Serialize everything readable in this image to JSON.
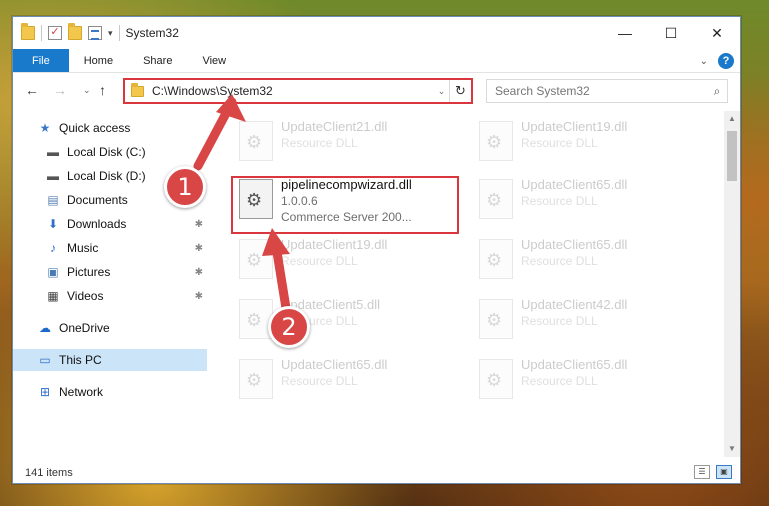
{
  "titlebar": {
    "title": "System32",
    "qa_dropdown": "▾",
    "buttons": {
      "minimize": "—",
      "maximize": "☐",
      "close": "✕"
    }
  },
  "ribbon": {
    "tabs": [
      "File",
      "Home",
      "Share",
      "View"
    ],
    "collapse": "⌄",
    "help": "?"
  },
  "navigation": {
    "back": "←",
    "forward": "→",
    "recent": "⌄",
    "up": "↑",
    "address": "C:\\Windows\\System32",
    "address_dropdown": "⌄",
    "refresh": "↻",
    "search_placeholder": "Search System32",
    "search_icon": "⌕"
  },
  "sidebar": {
    "items": [
      {
        "label": "Quick access",
        "icon": "star-icon",
        "glyph": "★",
        "color": "#3b78c9"
      },
      {
        "label": "Local Disk (C:)",
        "icon": "drive-icon",
        "glyph": "▬",
        "color": "#555555"
      },
      {
        "label": "Local Disk (D:)",
        "icon": "drive-icon",
        "glyph": "▬",
        "color": "#555555"
      },
      {
        "label": "Documents",
        "icon": "document-icon",
        "glyph": "▤",
        "color": "#5a7fb3"
      },
      {
        "label": "Downloads",
        "icon": "download-icon",
        "glyph": "⬇",
        "color": "#2f6fc9"
      },
      {
        "label": "Music",
        "icon": "music-icon",
        "glyph": "♪",
        "color": "#2f6fc9"
      },
      {
        "label": "Pictures",
        "icon": "pictures-icon",
        "glyph": "▣",
        "color": "#4a7bb7"
      },
      {
        "label": "Videos",
        "icon": "videos-icon",
        "glyph": "▦",
        "color": "#444444"
      },
      {
        "label": "OneDrive",
        "icon": "cloud-icon",
        "glyph": "☁",
        "color": "#1b6ac9"
      },
      {
        "label": "This PC",
        "icon": "computer-icon",
        "glyph": "▭",
        "color": "#2f6fc9"
      },
      {
        "label": "Network",
        "icon": "network-icon",
        "glyph": "⊞",
        "color": "#2f6fc9"
      }
    ],
    "pin": "📌"
  },
  "files": [
    {
      "name": "UpdateClient21.dll",
      "meta1": "Resource DLL",
      "meta2": ""
    },
    {
      "name": "UpdateClient19.dll",
      "meta1": "Resource DLL",
      "meta2": ""
    },
    {
      "name": "pipelinecompwizard.dll",
      "meta1": "1.0.0.6",
      "meta2": "Commerce Server 200..."
    },
    {
      "name": "UpdateClient65.dll",
      "meta1": "Resource DLL",
      "meta2": ""
    },
    {
      "name": "UpdateClient19.dll",
      "meta1": "Resource DLL",
      "meta2": ""
    },
    {
      "name": "UpdateClient65.dll",
      "meta1": "Resource DLL",
      "meta2": ""
    },
    {
      "name": "UpdateClient5.dll",
      "meta1": "Resource DLL",
      "meta2": ""
    },
    {
      "name": "UpdateClient42.dll",
      "meta1": "Resource DLL",
      "meta2": ""
    },
    {
      "name": "UpdateClient65.dll",
      "meta1": "Resource DLL",
      "meta2": ""
    },
    {
      "name": "UpdateClient65.dll",
      "meta1": "Resource DLL",
      "meta2": ""
    }
  ],
  "status": {
    "count": "141 items"
  },
  "annotations": {
    "step1": "1",
    "step2": "2",
    "color": "#d84646"
  }
}
